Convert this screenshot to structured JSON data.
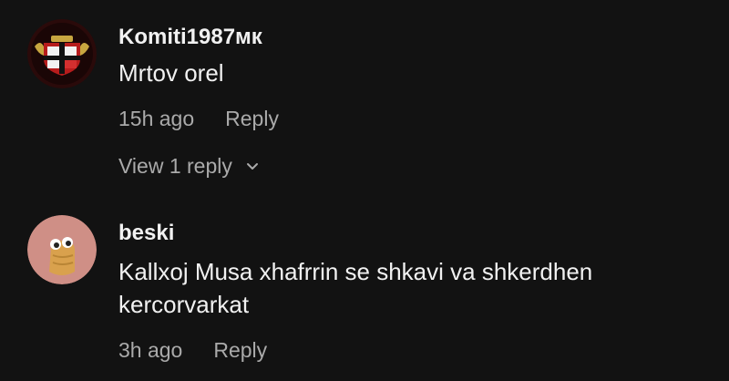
{
  "comments": [
    {
      "username": "Komiti1987мк",
      "text": "Mrtov orel",
      "time": "15h ago",
      "reply_label": "Reply",
      "view_replies": "View 1 reply",
      "avatar_icon": "club-crest-icon"
    },
    {
      "username": "beski",
      "text": "Kallxoj Musa xhafrrin se shkavi va shkerdhen kercorvarkat",
      "time": "3h ago",
      "reply_label": "Reply",
      "avatar_icon": "cartoon-character-icon"
    }
  ],
  "colors": {
    "background": "#121212",
    "primary_text": "#f1f1f1",
    "secondary_text": "#aaaaaa"
  }
}
